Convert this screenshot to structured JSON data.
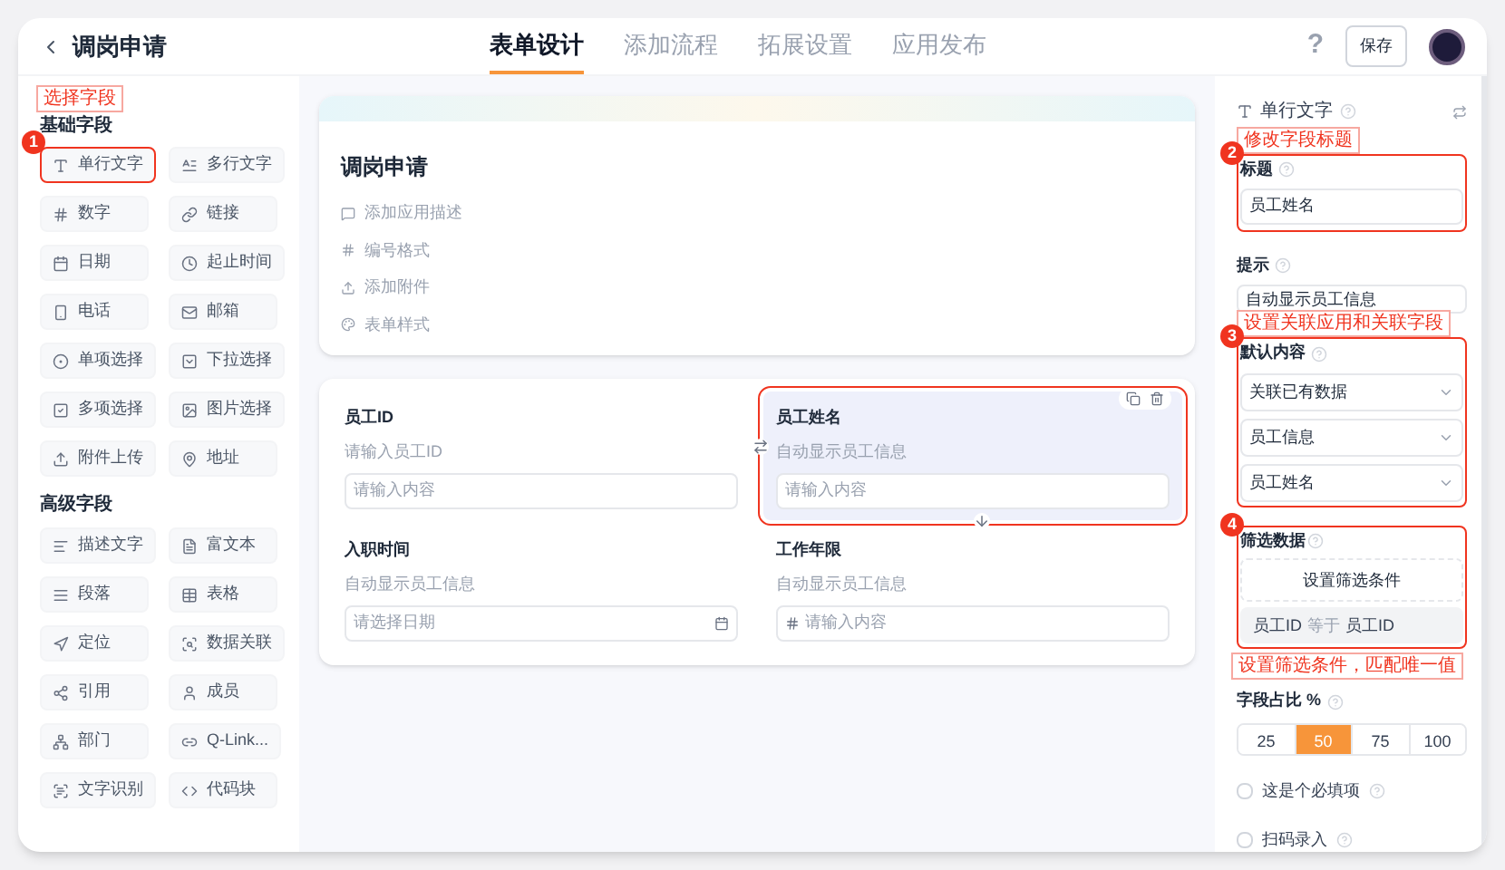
{
  "header": {
    "title": "调岗申请",
    "tabs": [
      {
        "label": "表单设计",
        "selected": true
      },
      {
        "label": "添加流程",
        "selected": false
      },
      {
        "label": "拓展设置",
        "selected": false
      },
      {
        "label": "应用发布",
        "selected": false
      }
    ],
    "help": "?",
    "save": "保存"
  },
  "annotations": [
    {
      "step": "1",
      "label": "选择字段"
    },
    {
      "step": "2",
      "label": "修改字段标题"
    },
    {
      "step": "3",
      "label": "设置关联应用和关联字段"
    },
    {
      "step": "4",
      "label": "设置筛选条件，匹配唯一值"
    }
  ],
  "palette": {
    "groups": [
      {
        "title": "基础字段",
        "items": [
          {
            "label": "单行文字",
            "highlighted": true
          },
          {
            "label": "多行文字",
            "highlighted": false
          },
          {
            "label": "数字",
            "highlighted": false
          },
          {
            "label": "链接",
            "highlighted": false
          },
          {
            "label": "日期",
            "highlighted": false
          },
          {
            "label": "起止时间",
            "highlighted": false
          },
          {
            "label": "电话",
            "highlighted": false
          },
          {
            "label": "邮箱",
            "highlighted": false
          },
          {
            "label": "单项选择",
            "highlighted": false
          },
          {
            "label": "下拉选择",
            "highlighted": false
          },
          {
            "label": "多项选择",
            "highlighted": false
          },
          {
            "label": "图片选择",
            "highlighted": false
          },
          {
            "label": "附件上传",
            "highlighted": false
          },
          {
            "label": "地址",
            "highlighted": false
          }
        ]
      },
      {
        "title": "高级字段",
        "items": [
          {
            "label": "描述文字",
            "highlighted": false
          },
          {
            "label": "富文本",
            "highlighted": false
          },
          {
            "label": "段落",
            "highlighted": false
          },
          {
            "label": "表格",
            "highlighted": false
          },
          {
            "label": "定位",
            "highlighted": false
          },
          {
            "label": "数据关联",
            "highlighted": false
          },
          {
            "label": "引用",
            "highlighted": false
          },
          {
            "label": "成员",
            "highlighted": false
          },
          {
            "label": "部门",
            "highlighted": false
          },
          {
            "label": "Q-Link...",
            "highlighted": false
          },
          {
            "label": "文字识别",
            "highlighted": false
          },
          {
            "label": "代码块",
            "highlighted": false
          }
        ]
      }
    ]
  },
  "form": {
    "title": "调岗申请",
    "links": [
      "添加应用描述",
      "编号格式",
      "添加附件",
      "表单样式"
    ],
    "fields": [
      {
        "kind": "text",
        "label": "员工ID",
        "hint": "请输入员工ID",
        "placeholder": "请输入内容",
        "selected": false
      },
      {
        "kind": "text",
        "label": "员工姓名",
        "hint": "自动显示员工信息",
        "placeholder": "请输入内容",
        "selected": true
      },
      {
        "kind": "date",
        "label": "入职时间",
        "hint": "自动显示员工信息",
        "placeholder": "请选择日期",
        "selected": false
      },
      {
        "kind": "number",
        "label": "工作年限",
        "hint": "自动显示员工信息",
        "placeholder": "请输入内容",
        "selected": false
      }
    ]
  },
  "properties": {
    "field_type": "单行文字",
    "title": {
      "label": "标题",
      "value": "员工姓名"
    },
    "hint": {
      "label": "提示",
      "value": "自动显示员工信息"
    },
    "default": {
      "label": "默认内容",
      "selects": [
        "关联已有数据",
        "员工信息",
        "员工姓名"
      ]
    },
    "filter": {
      "label": "筛选数据",
      "button": "设置筛选条件",
      "condition": {
        "field": "员工ID",
        "operator": "等于",
        "value": "员工ID"
      }
    },
    "width": {
      "label": "字段占比 %",
      "options": [
        {
          "label": "25",
          "selected": false
        },
        {
          "label": "50",
          "selected": true
        },
        {
          "label": "75",
          "selected": false
        },
        {
          "label": "100",
          "selected": false
        }
      ]
    },
    "checks": [
      {
        "label": "这是个必填项",
        "checked": false
      },
      {
        "label": "扫码录入",
        "checked": false
      }
    ]
  }
}
